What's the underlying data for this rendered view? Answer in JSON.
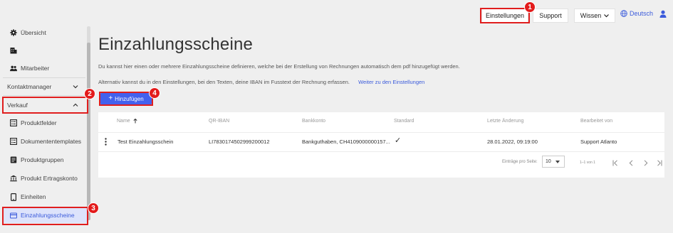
{
  "topbar": {
    "settings": "Einstellungen",
    "support": "Support",
    "knowledge": "Wissen",
    "language": "Deutsch"
  },
  "sidebar": {
    "items": [
      {
        "label": "Übersicht"
      },
      {
        "label": ""
      },
      {
        "label": "Mitarbeiter"
      },
      {
        "label": "Kontaktmanager"
      },
      {
        "label": "Verkauf"
      },
      {
        "label": "Produktfelder"
      },
      {
        "label": "Dokumententemplates"
      },
      {
        "label": "Produktgruppen"
      },
      {
        "label": "Produkt Ertragskonto"
      },
      {
        "label": "Einheiten"
      },
      {
        "label": "Einzahlungsscheine"
      }
    ]
  },
  "main": {
    "title": "Einzahlungsscheine",
    "description": "Du kannst hier einen oder mehrere Einzahlungsscheine definieren, welche bei der Erstellung von Rechnungen automatisch dem pdf hinzugefügt werden.",
    "description2": "Alternativ kannst du in den Einstellungen, bei den Texten, deine IBAN im Fusstext der Rechnung erfassen.",
    "settings_link": "Weiter zu den Einstellungen",
    "add_button": "Hinzufügen"
  },
  "table": {
    "columns": [
      "Name",
      "QR-IBAN",
      "Bankkonto",
      "Standard",
      "Letzte Änderung",
      "Bearbeitet von"
    ],
    "rows": [
      {
        "name": "Test Einzahlungsschein",
        "qr_iban": "LI7830174502999200012",
        "bank": "Bankguthaben, CH4109000000157...",
        "standard": "✓",
        "changed": "28.01.2022, 09:19:00",
        "by": "Support Atlanto"
      }
    ],
    "pager": {
      "per_page_label": "Einträge pro Seite:",
      "per_page": "10",
      "range": "1–1 von 1"
    }
  },
  "annotations": [
    "1",
    "2",
    "3",
    "4"
  ],
  "colors": {
    "accent": "#4361ee",
    "highlight": "#e01e1e",
    "active_bg": "#dde3fb"
  }
}
